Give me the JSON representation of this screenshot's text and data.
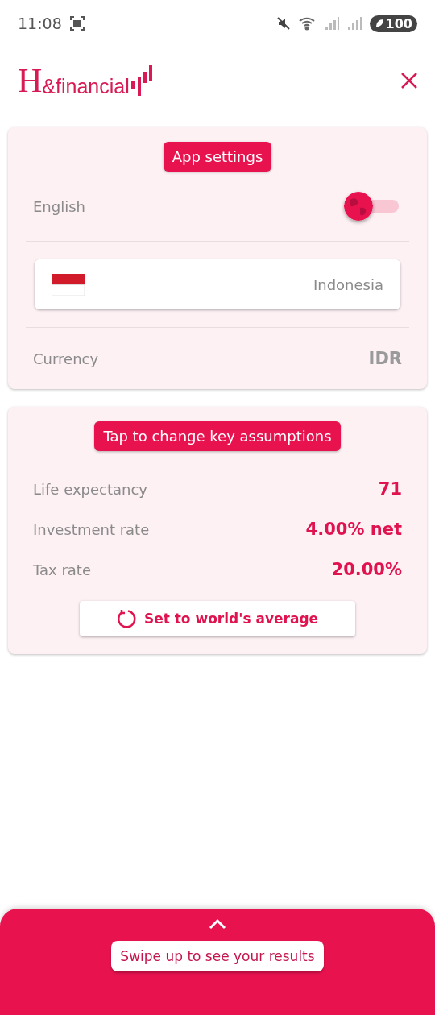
{
  "status_bar": {
    "time": "11:08",
    "battery": "100"
  },
  "header": {
    "logo_initial": "H",
    "logo_name": "&financial"
  },
  "app_settings": {
    "title": "App settings",
    "language": {
      "label": "English",
      "on": false
    },
    "country": {
      "name": "Indonesia"
    },
    "currency": {
      "label": "Currency",
      "value": "IDR"
    }
  },
  "assumptions": {
    "title": "Tap to change key assumptions",
    "rows": [
      {
        "label": "Life expectancy",
        "value": "71"
      },
      {
        "label": "Investment rate",
        "value": "4.00% net"
      },
      {
        "label": "Tax rate",
        "value": "20.00%"
      }
    ],
    "reset_button": "Set to world's average"
  },
  "bottom_sheet": {
    "button": "Swipe up to see your results"
  }
}
